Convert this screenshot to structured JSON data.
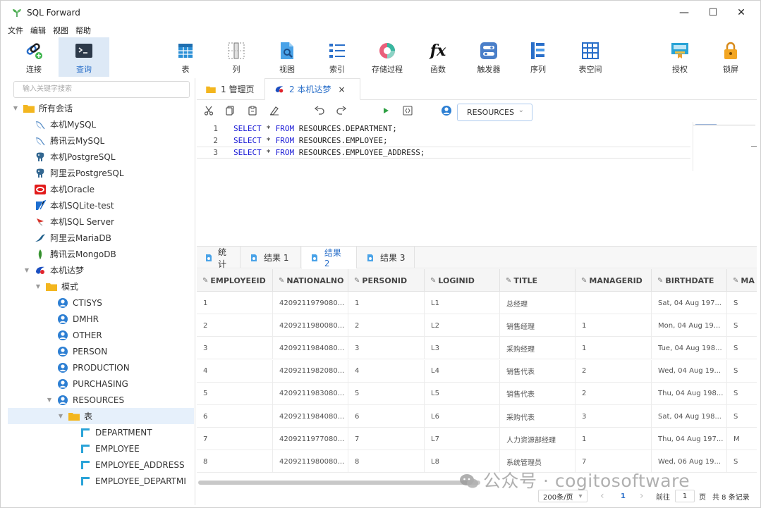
{
  "window": {
    "title": "SQL Forward",
    "minimize": "—",
    "maximize": "☐",
    "close": "✕"
  },
  "menu": [
    "文件",
    "编辑",
    "视图",
    "帮助"
  ],
  "toolbar": {
    "items": [
      {
        "label": "连接",
        "icon": "connect-icon"
      },
      {
        "label": "查询",
        "icon": "terminal-icon",
        "active": true
      },
      {
        "label": "表",
        "icon": "table-icon"
      },
      {
        "label": "列",
        "icon": "column-icon"
      },
      {
        "label": "视图",
        "icon": "view-icon"
      },
      {
        "label": "索引",
        "icon": "index-icon"
      },
      {
        "label": "存储过程",
        "icon": "procedure-icon"
      },
      {
        "label": "函数",
        "icon": "function-icon"
      },
      {
        "label": "触发器",
        "icon": "trigger-icon"
      },
      {
        "label": "序列",
        "icon": "sequence-icon"
      },
      {
        "label": "表空间",
        "icon": "tablespace-icon"
      },
      {
        "label": "授权",
        "icon": "grant-icon"
      },
      {
        "label": "锁屏",
        "icon": "lock-icon"
      }
    ],
    "fx_glyph": "fx"
  },
  "sidebar": {
    "search_placeholder": "输入关键字搜索",
    "tree": [
      {
        "label": "所有会话",
        "icon": "folder-icon",
        "caret": "▼"
      },
      {
        "label": "本机MySQL",
        "icon": "mysql-icon"
      },
      {
        "label": "腾讯云MySQL",
        "icon": "mysql-icon"
      },
      {
        "label": "本机PostgreSQL",
        "icon": "postgresql-icon"
      },
      {
        "label": "阿里云PostgreSQL",
        "icon": "postgresql-icon"
      },
      {
        "label": "本机Oracle",
        "icon": "oracle-icon"
      },
      {
        "label": "本机SQLite-test",
        "icon": "sqlite-icon"
      },
      {
        "label": "本机SQL Server",
        "icon": "sqlserver-icon"
      },
      {
        "label": "阿里云MariaDB",
        "icon": "mariadb-icon"
      },
      {
        "label": "腾讯云MongoDB",
        "icon": "mongodb-icon"
      },
      {
        "label": "本机达梦",
        "icon": "dameng-icon",
        "caret": "▼"
      },
      {
        "label": "模式",
        "icon": "folder-icon",
        "caret": "▼"
      },
      {
        "label": "CTISYS",
        "icon": "schema-icon"
      },
      {
        "label": "DMHR",
        "icon": "schema-icon"
      },
      {
        "label": "OTHER",
        "icon": "schema-icon"
      },
      {
        "label": "PERSON",
        "icon": "schema-icon"
      },
      {
        "label": "PRODUCTION",
        "icon": "schema-icon"
      },
      {
        "label": "PURCHASING",
        "icon": "schema-icon"
      },
      {
        "label": "RESOURCES",
        "icon": "schema-icon",
        "caret": "▼"
      },
      {
        "label": "表",
        "icon": "folder-icon",
        "caret": "▼",
        "selected": true
      },
      {
        "label": "DEPARTMENT",
        "icon": "table-icon"
      },
      {
        "label": "EMPLOYEE",
        "icon": "table-icon"
      },
      {
        "label": "EMPLOYEE_ADDRESS",
        "icon": "table-icon"
      },
      {
        "label": "EMPLOYEE_DEPARTMI",
        "icon": "table-icon"
      }
    ]
  },
  "editor_tabs": [
    {
      "label": "1 管理页",
      "icon": "folder-icon"
    },
    {
      "label": "2 本机达梦",
      "icon": "dameng-icon",
      "active": true,
      "close": "×"
    }
  ],
  "schema_select": {
    "value": "RESOURCES"
  },
  "code": [
    {
      "num": "1",
      "kw1": "SELECT",
      "mid": " * ",
      "kw2": "FROM",
      "rest": " RESOURCES.DEPARTMENT;"
    },
    {
      "num": "2",
      "kw1": "SELECT",
      "mid": " * ",
      "kw2": "FROM",
      "rest": " RESOURCES.EMPLOYEE;"
    },
    {
      "num": "3",
      "kw1": "SELECT",
      "mid": " * ",
      "kw2": "FROM",
      "rest": " RESOURCES.EMPLOYEE_ADDRESS;"
    }
  ],
  "result_tabs": [
    {
      "label": "统计"
    },
    {
      "label": "结果 1"
    },
    {
      "label": "结果 2",
      "active": true
    },
    {
      "label": "结果 3"
    }
  ],
  "grid": {
    "columns": [
      "EMPLOYEEID",
      "NATIONALNO",
      "PERSONID",
      "LOGINID",
      "TITLE",
      "MANAGERID",
      "BIRTHDATE",
      "MA"
    ],
    "rows": [
      [
        "1",
        "4209211979080...",
        "1",
        "L1",
        "总经理",
        "",
        "Sat, 04 Aug 197...",
        "S"
      ],
      [
        "2",
        "4209211980080...",
        "2",
        "L2",
        "销售经理",
        "1",
        "Mon, 04 Aug 19...",
        "S"
      ],
      [
        "3",
        "4209211984080...",
        "3",
        "L3",
        "采购经理",
        "1",
        "Tue, 04 Aug 198...",
        "S"
      ],
      [
        "4",
        "4209211982080...",
        "4",
        "L4",
        "销售代表",
        "2",
        "Wed, 04 Aug 19...",
        "S"
      ],
      [
        "5",
        "4209211983080...",
        "5",
        "L5",
        "销售代表",
        "2",
        "Thu, 04 Aug 198...",
        "S"
      ],
      [
        "6",
        "4209211984080...",
        "6",
        "L6",
        "采购代表",
        "3",
        "Sat, 04 Aug 198...",
        "S"
      ],
      [
        "7",
        "4209211977080...",
        "7",
        "L7",
        "人力资源部经理",
        "1",
        "Thu, 04 Aug 197...",
        "M"
      ],
      [
        "8",
        "4209211980080...",
        "8",
        "L8",
        "系统管理员",
        "7",
        "Wed, 06 Aug 19...",
        "S"
      ]
    ]
  },
  "pager": {
    "page_size": "200条/页",
    "current_page": "1",
    "goto_label": "前往",
    "goto_value": "1",
    "page_suffix": "页",
    "total": "共 8 条记录",
    "prev": "‹",
    "next": "›",
    "dropdown": "▾"
  },
  "watermark": "公众号 · cogitosoftware"
}
